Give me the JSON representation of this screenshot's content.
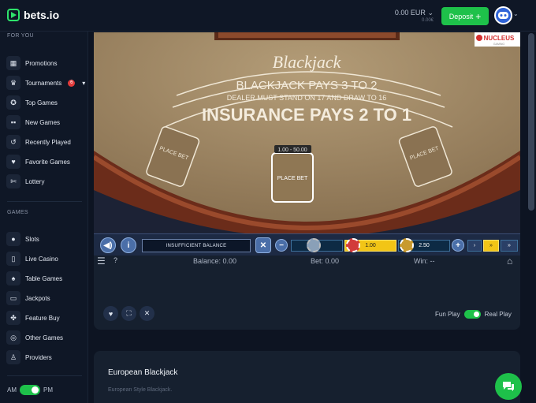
{
  "brand": {
    "name": "bets.io"
  },
  "header": {
    "balance": "0.00 EUR",
    "balance_sub": "0.00€",
    "deposit_label": "Deposit"
  },
  "sidebar": {
    "section_for_you": "FOR YOU",
    "for_you_items": [
      {
        "label": "Promotions",
        "icon": "gift-icon"
      },
      {
        "label": "Tournaments",
        "icon": "trophy-icon",
        "badge": "6"
      },
      {
        "label": "Top Games",
        "icon": "medal-icon"
      },
      {
        "label": "New Games",
        "icon": "grid-icon"
      },
      {
        "label": "Recently Played",
        "icon": "history-icon"
      },
      {
        "label": "Favorite Games",
        "icon": "heart-icon"
      },
      {
        "label": "Lottery",
        "icon": "ticket-icon"
      }
    ],
    "section_games": "GAMES",
    "games_items": [
      {
        "label": "Slots",
        "icon": "slots-icon"
      },
      {
        "label": "Live Casino",
        "icon": "live-icon"
      },
      {
        "label": "Table Games",
        "icon": "cards-icon"
      },
      {
        "label": "Jackpots",
        "icon": "jackpot-icon"
      },
      {
        "label": "Feature Buy",
        "icon": "feature-icon"
      },
      {
        "label": "Other Games",
        "icon": "other-icon"
      },
      {
        "label": "Providers",
        "icon": "providers-icon"
      }
    ],
    "am": "AM",
    "pm": "PM"
  },
  "game": {
    "provider": "NUCLEUS",
    "provider_sub": "GAMING",
    "title": "Blackjack",
    "line1": "BLACKJACK PAYS 3 TO 2",
    "line2": "DEALER MUST STAND ON 17 AND DRAW TO 16",
    "line3": "INSURANCE PAYS 2 TO 1",
    "place_bet": "PLACE BET",
    "limit": "1.00 - 50.00",
    "message": "INSUFFICIENT BALANCE",
    "chip1": "1.00",
    "chip2": "2.50",
    "balance": "Balance: 0.00",
    "bet": "Bet: 0.00",
    "win": "Win: --"
  },
  "actions": {
    "fun_play": "Fun Play",
    "real_play": "Real Play"
  },
  "description": {
    "title": "European Blackjack",
    "subtitle": "European Style Blackjack."
  }
}
